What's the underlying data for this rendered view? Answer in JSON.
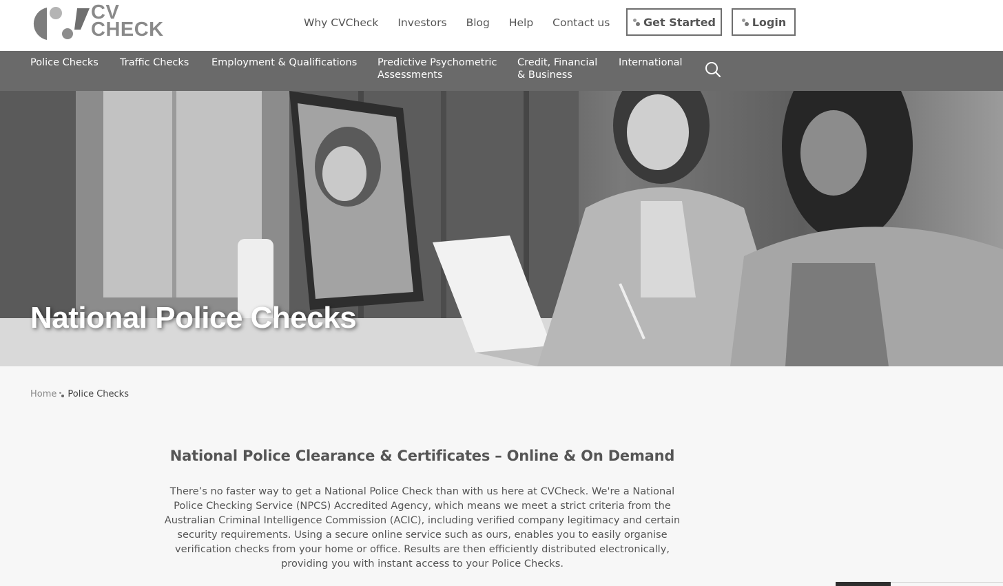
{
  "header": {
    "logo_line1": "CV",
    "logo_line2": "CHECK",
    "nav": [
      "Why CVCheck",
      "Investors",
      "Blog",
      "Help",
      "Contact us"
    ],
    "get_started_label": "Get Started",
    "login_label": "Login"
  },
  "categories": [
    {
      "lines": [
        "Police Checks"
      ]
    },
    {
      "lines": [
        "Traffic Checks"
      ]
    },
    {
      "lines": [
        "Employment & Qualifications"
      ]
    },
    {
      "lines": [
        "Predictive Psychometric",
        "Assessments"
      ]
    },
    {
      "lines": [
        "Credit, Financial",
        "& Business"
      ]
    },
    {
      "lines": [
        "International"
      ]
    }
  ],
  "hero": {
    "title": "National Police Checks"
  },
  "breadcrumb": {
    "home": "Home",
    "current": "Police Checks"
  },
  "main": {
    "heading": "National Police Clearance & Certificates – Online & On Demand",
    "intro": "There’s no faster way to get a National Police Check than with us here at CVCheck. We're a National Police Checking Service (NPCS) Accredited Agency, which means we meet a strict criteria from the Australian Criminal Intelligence Commission (ACIC), including verified company legitimacy and certain security requirements. Using a secure online service such as ours, enables you to easily organise verification checks from your home or office. Results are then efficiently distributed electronically, providing you with instant access to your Police Checks."
  },
  "colors": {
    "category_bar": "#6a6a6a",
    "text": "#555555",
    "page_background": "#f7f7f7"
  },
  "icons": [
    "logo-mark",
    "search-icon",
    "dots-icon"
  ]
}
